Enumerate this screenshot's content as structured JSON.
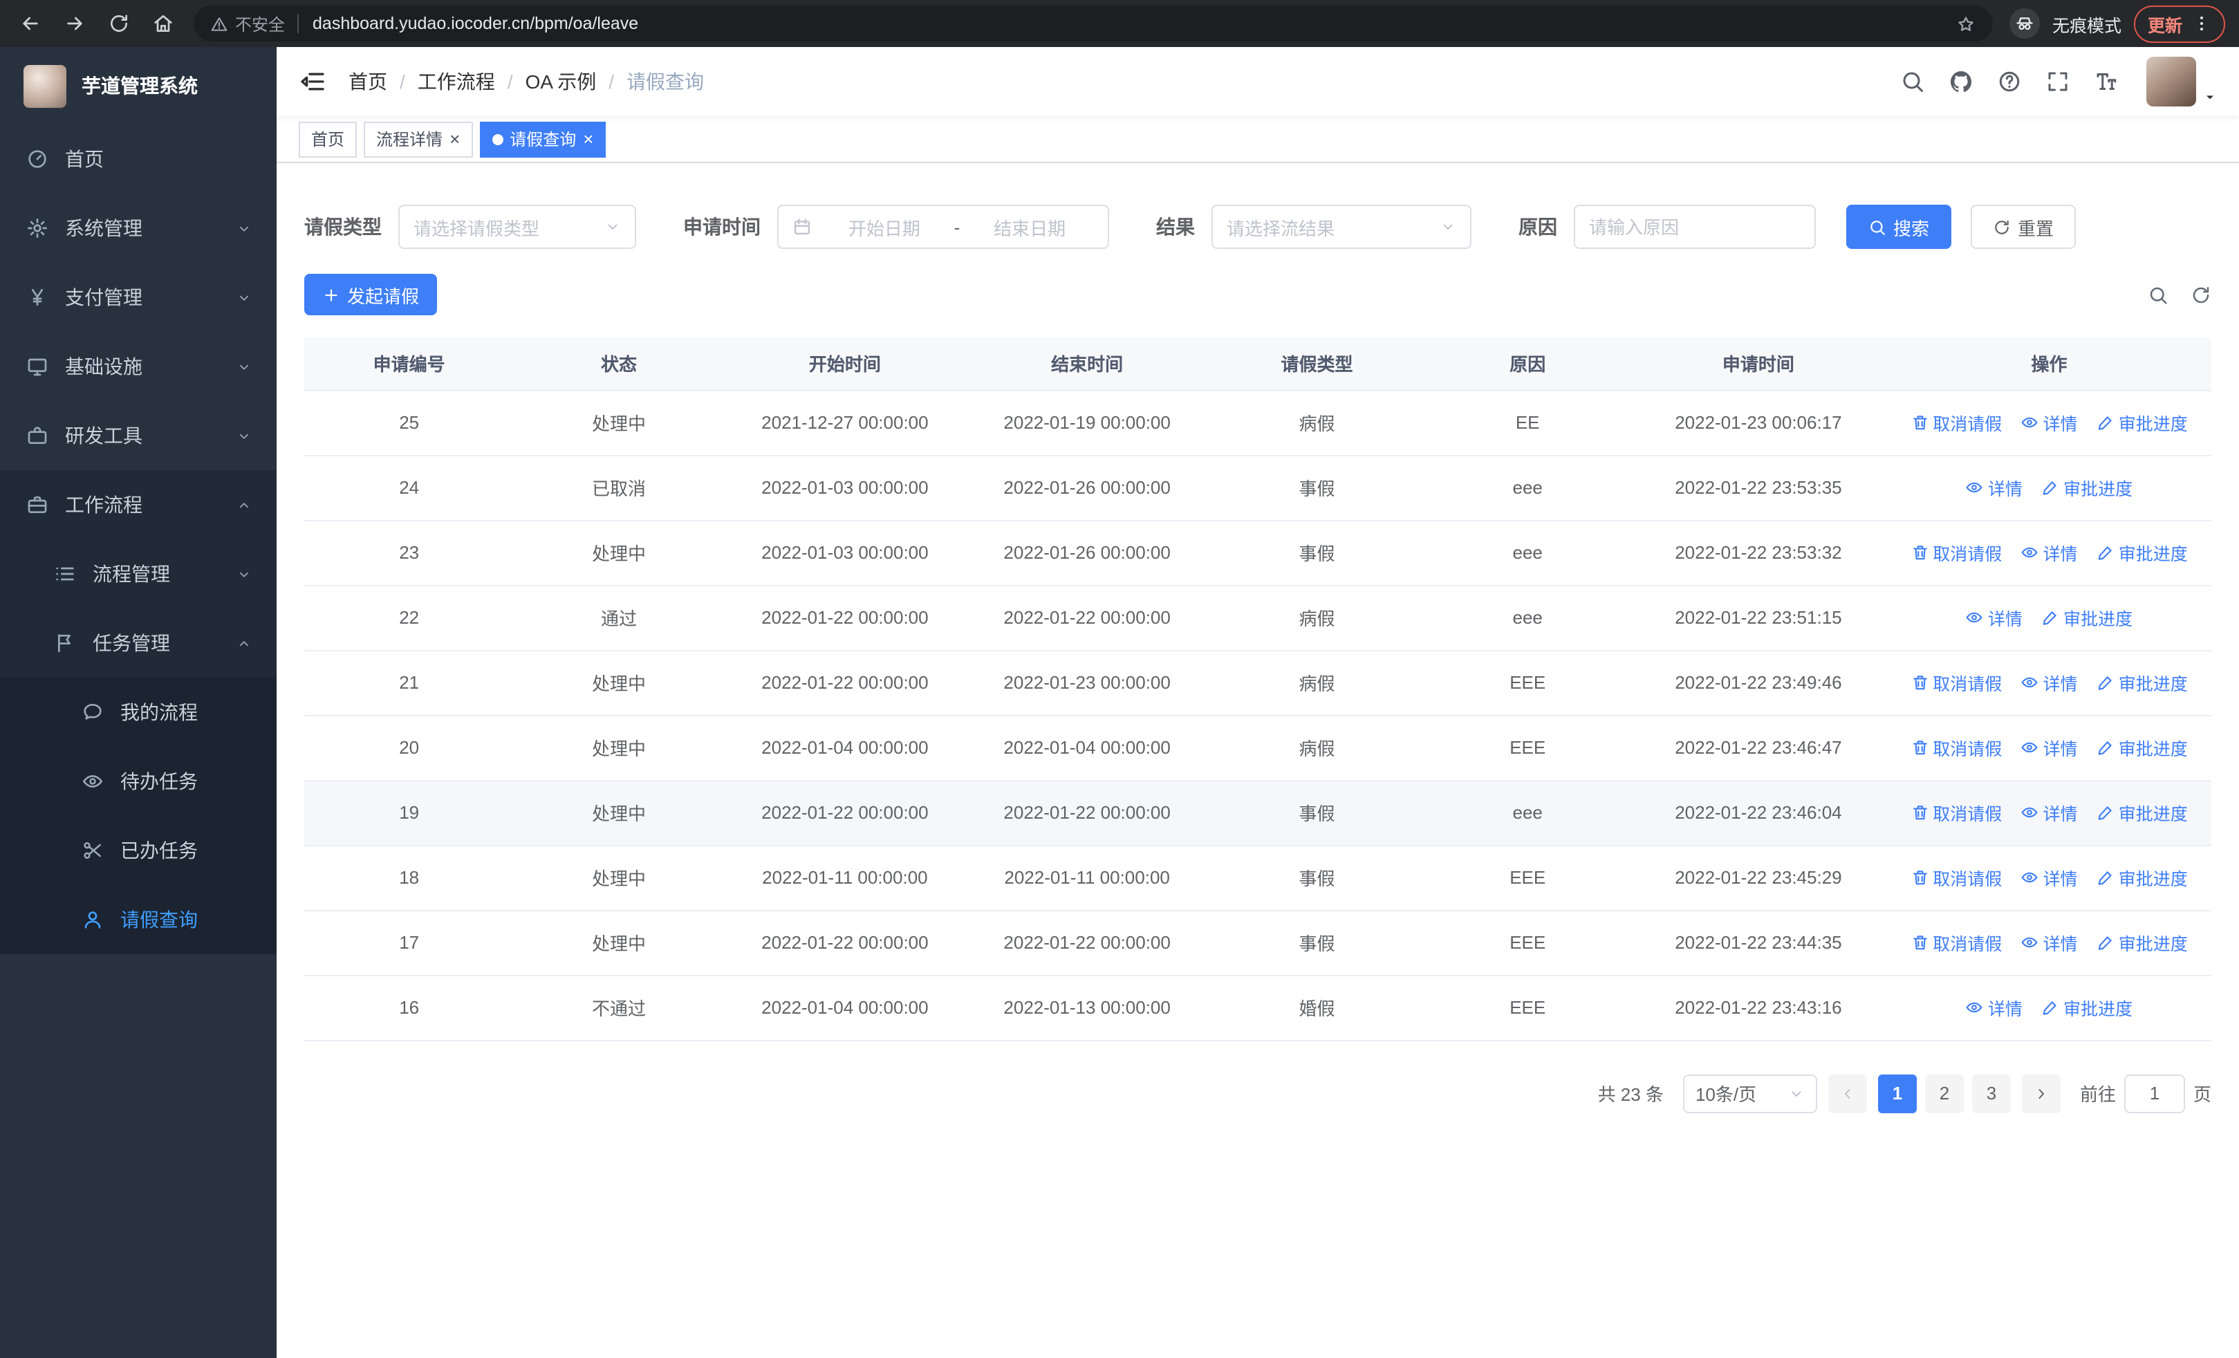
{
  "colors": {
    "primary": "#3e7ef7",
    "active_menu": "#409eff",
    "sidebar_bg": "#28323f",
    "sidebar_sub": "#212b38",
    "sidebar_deep": "#1b2430",
    "chrome_bg": "#27282b",
    "omnibox_bg": "#1d1e21",
    "update_red": "#e0564a"
  },
  "browser": {
    "security_label": "不安全",
    "url": "dashboard.yudao.iocoder.cn/bpm/oa/leave",
    "incognito_label": "无痕模式",
    "update_label": "更新"
  },
  "sidebar": {
    "logo_title": "芋道管理系统",
    "menu": [
      {
        "name": "home",
        "label": "首页",
        "icon": "dashboard-icon",
        "indent": 1,
        "tier": 0,
        "chevron": null,
        "active": false
      },
      {
        "name": "system-management",
        "label": "系统管理",
        "icon": "gear-icon",
        "indent": 1,
        "tier": 0,
        "chevron": "down",
        "active": false
      },
      {
        "name": "payment-management",
        "label": "支付管理",
        "icon": "yen-icon",
        "indent": 1,
        "tier": 0,
        "chevron": "down",
        "active": false
      },
      {
        "name": "infrastructure",
        "label": "基础设施",
        "icon": "monitor-icon",
        "indent": 1,
        "tier": 0,
        "chevron": "down",
        "active": false
      },
      {
        "name": "dev-tools",
        "label": "研发工具",
        "icon": "tools-icon",
        "indent": 1,
        "tier": 0,
        "chevron": "down",
        "active": false
      },
      {
        "name": "workflow",
        "label": "工作流程",
        "icon": "briefcase-icon",
        "indent": 1,
        "tier": 1,
        "chevron": "up",
        "active": false
      },
      {
        "name": "process-management",
        "label": "流程管理",
        "icon": "list-icon",
        "indent": 2,
        "tier": 1,
        "chevron": "down",
        "active": false
      },
      {
        "name": "task-management",
        "label": "任务管理",
        "icon": "flag-icon",
        "indent": 2,
        "tier": 1,
        "chevron": "up",
        "active": false
      },
      {
        "name": "my-process",
        "label": "我的流程",
        "icon": "chat-icon",
        "indent": 3,
        "tier": 2,
        "chevron": null,
        "active": false
      },
      {
        "name": "todo-tasks",
        "label": "待办任务",
        "icon": "eye-icon",
        "indent": 3,
        "tier": 2,
        "chevron": null,
        "active": false
      },
      {
        "name": "done-tasks",
        "label": "已办任务",
        "icon": "scissors-icon",
        "indent": 3,
        "tier": 2,
        "chevron": null,
        "active": false
      },
      {
        "name": "leave-query",
        "label": "请假查询",
        "icon": "user-icon",
        "indent": 3,
        "tier": 2,
        "chevron": null,
        "active": true
      }
    ]
  },
  "header": {
    "breadcrumb": [
      "首页",
      "工作流程",
      "OA 示例",
      "请假查询"
    ]
  },
  "tabs": [
    {
      "name": "home",
      "label": "首页",
      "closable": false,
      "active": false
    },
    {
      "name": "process-detail",
      "label": "流程详情",
      "closable": true,
      "active": false
    },
    {
      "name": "leave-query",
      "label": "请假查询",
      "closable": true,
      "active": true
    }
  ],
  "filters": {
    "leave_type_label": "请假类型",
    "leave_type_placeholder": "请选择请假类型",
    "apply_time_label": "申请时间",
    "start_date_placeholder": "开始日期",
    "range_separator": "-",
    "end_date_placeholder": "结束日期",
    "result_label": "结果",
    "result_placeholder": "请选择流结果",
    "reason_label": "原因",
    "reason_placeholder": "请输入原因",
    "search_label": "搜索",
    "reset_label": "重置"
  },
  "toolbar": {
    "create_label": "发起请假"
  },
  "table": {
    "columns": [
      "申请编号",
      "状态",
      "开始时间",
      "结束时间",
      "请假类型",
      "原因",
      "申请时间",
      "操作"
    ],
    "action_labels": {
      "cancel": "取消请假",
      "detail": "详情",
      "progress": "审批进度"
    },
    "rows": [
      {
        "id": "25",
        "status": "处理中",
        "start": "2021-12-27 00:00:00",
        "end": "2022-01-19 00:00:00",
        "type": "病假",
        "reason": "EE",
        "apply_time": "2022-01-23 00:06:17",
        "cancelable": true
      },
      {
        "id": "24",
        "status": "已取消",
        "start": "2022-01-03 00:00:00",
        "end": "2022-01-26 00:00:00",
        "type": "事假",
        "reason": "eee",
        "apply_time": "2022-01-22 23:53:35",
        "cancelable": false
      },
      {
        "id": "23",
        "status": "处理中",
        "start": "2022-01-03 00:00:00",
        "end": "2022-01-26 00:00:00",
        "type": "事假",
        "reason": "eee",
        "apply_time": "2022-01-22 23:53:32",
        "cancelable": true
      },
      {
        "id": "22",
        "status": "通过",
        "start": "2022-01-22 00:00:00",
        "end": "2022-01-22 00:00:00",
        "type": "病假",
        "reason": "eee",
        "apply_time": "2022-01-22 23:51:15",
        "cancelable": false
      },
      {
        "id": "21",
        "status": "处理中",
        "start": "2022-01-22 00:00:00",
        "end": "2022-01-23 00:00:00",
        "type": "病假",
        "reason": "EEE",
        "apply_time": "2022-01-22 23:49:46",
        "cancelable": true
      },
      {
        "id": "20",
        "status": "处理中",
        "start": "2022-01-04 00:00:00",
        "end": "2022-01-04 00:00:00",
        "type": "病假",
        "reason": "EEE",
        "apply_time": "2022-01-22 23:46:47",
        "cancelable": true
      },
      {
        "id": "19",
        "status": "处理中",
        "start": "2022-01-22 00:00:00",
        "end": "2022-01-22 00:00:00",
        "type": "事假",
        "reason": "eee",
        "apply_time": "2022-01-22 23:46:04",
        "cancelable": true,
        "hover": true
      },
      {
        "id": "18",
        "status": "处理中",
        "start": "2022-01-11 00:00:00",
        "end": "2022-01-11 00:00:00",
        "type": "事假",
        "reason": "EEE",
        "apply_time": "2022-01-22 23:45:29",
        "cancelable": true
      },
      {
        "id": "17",
        "status": "处理中",
        "start": "2022-01-22 00:00:00",
        "end": "2022-01-22 00:00:00",
        "type": "事假",
        "reason": "EEE",
        "apply_time": "2022-01-22 23:44:35",
        "cancelable": true
      },
      {
        "id": "16",
        "status": "不通过",
        "start": "2022-01-04 00:00:00",
        "end": "2022-01-13 00:00:00",
        "type": "婚假",
        "reason": "EEE",
        "apply_time": "2022-01-22 23:43:16",
        "cancelable": false
      }
    ]
  },
  "pagination": {
    "total_label": "共 23 条",
    "page_size": "10条/页",
    "pages": [
      "1",
      "2",
      "3"
    ],
    "active_page": "1",
    "goto_label": "前往",
    "goto_value": "1",
    "page_unit": "页"
  }
}
